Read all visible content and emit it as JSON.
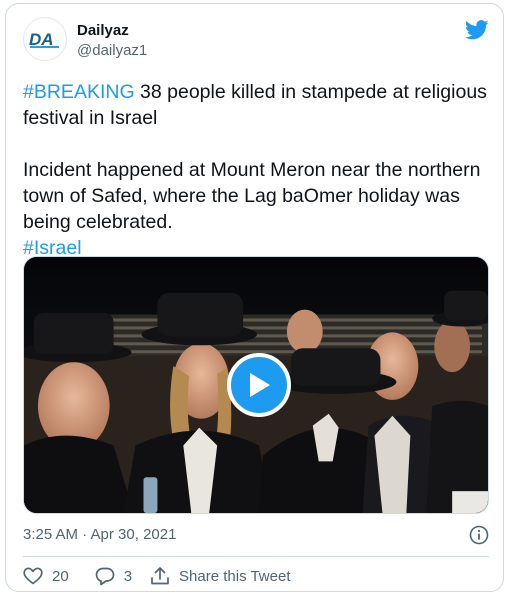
{
  "author": {
    "display_name": "Dailyaz",
    "handle": "@dailyaz1",
    "avatar_text": "DA"
  },
  "tweet": {
    "hashtag_breaking": "#BREAKING",
    "headline": " 38 people killed in stampede at religious festival in Israel",
    "body": "Incident happened at Mount Meron near the northern town of Safed, where the Lag baOmer holiday was being celebrated.",
    "hashtag_israel": "#Israel"
  },
  "media": {
    "type": "video",
    "play_icon": "play-icon"
  },
  "meta": {
    "timestamp": "3:25 AM · Apr 30, 2021",
    "info_icon": "info-icon"
  },
  "actions": {
    "like_count": "20",
    "reply_count": "3",
    "share_label": "Share this Tweet"
  },
  "colors": {
    "accent": "#1d9bf0",
    "text": "#0f1419",
    "secondary": "#536471",
    "border": "#cfd9de"
  }
}
